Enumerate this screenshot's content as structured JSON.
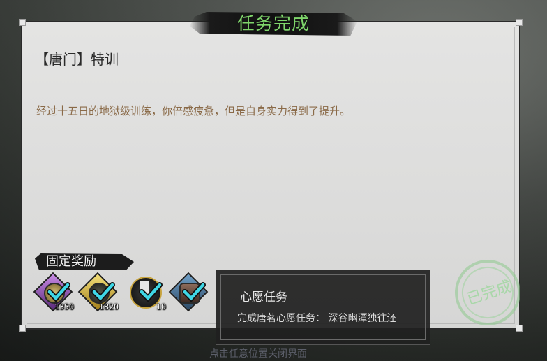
{
  "banner": {
    "title": "任务完成"
  },
  "quest": {
    "title": "【唐门】特训",
    "description": "经过十五日的地狱级训练，你倍感疲惫，但是自身实力得到了提升。"
  },
  "rewards": {
    "label": "固定奖励",
    "items": [
      {
        "icon": "purple-orb-item-icon",
        "count": "1350",
        "claimed": true
      },
      {
        "icon": "gold-orb-item-icon",
        "count": "1820",
        "claimed": true
      },
      {
        "icon": "character-card-icon",
        "count": "10",
        "claimed": true
      },
      {
        "icon": "armor-item-icon",
        "count": "",
        "claimed": true
      },
      {
        "icon": "dark-item-icon",
        "count": "",
        "claimed": true
      },
      {
        "icon": "bronze-item-icon",
        "count": "",
        "claimed": true
      },
      {
        "icon": "red-orb-item-icon",
        "count": "",
        "claimed": true
      }
    ]
  },
  "stamp": {
    "text": "已完成"
  },
  "tooltip": {
    "title": "心愿任务",
    "description": "完成唐茗心愿任务：  深谷幽潭独往还"
  },
  "footer": {
    "close_hint": "点击任意位置关闭界面"
  },
  "colors": {
    "title_green": "#7fd66b",
    "description_brown": "#8a6a48",
    "check_cyan": "#3fd7e6"
  }
}
